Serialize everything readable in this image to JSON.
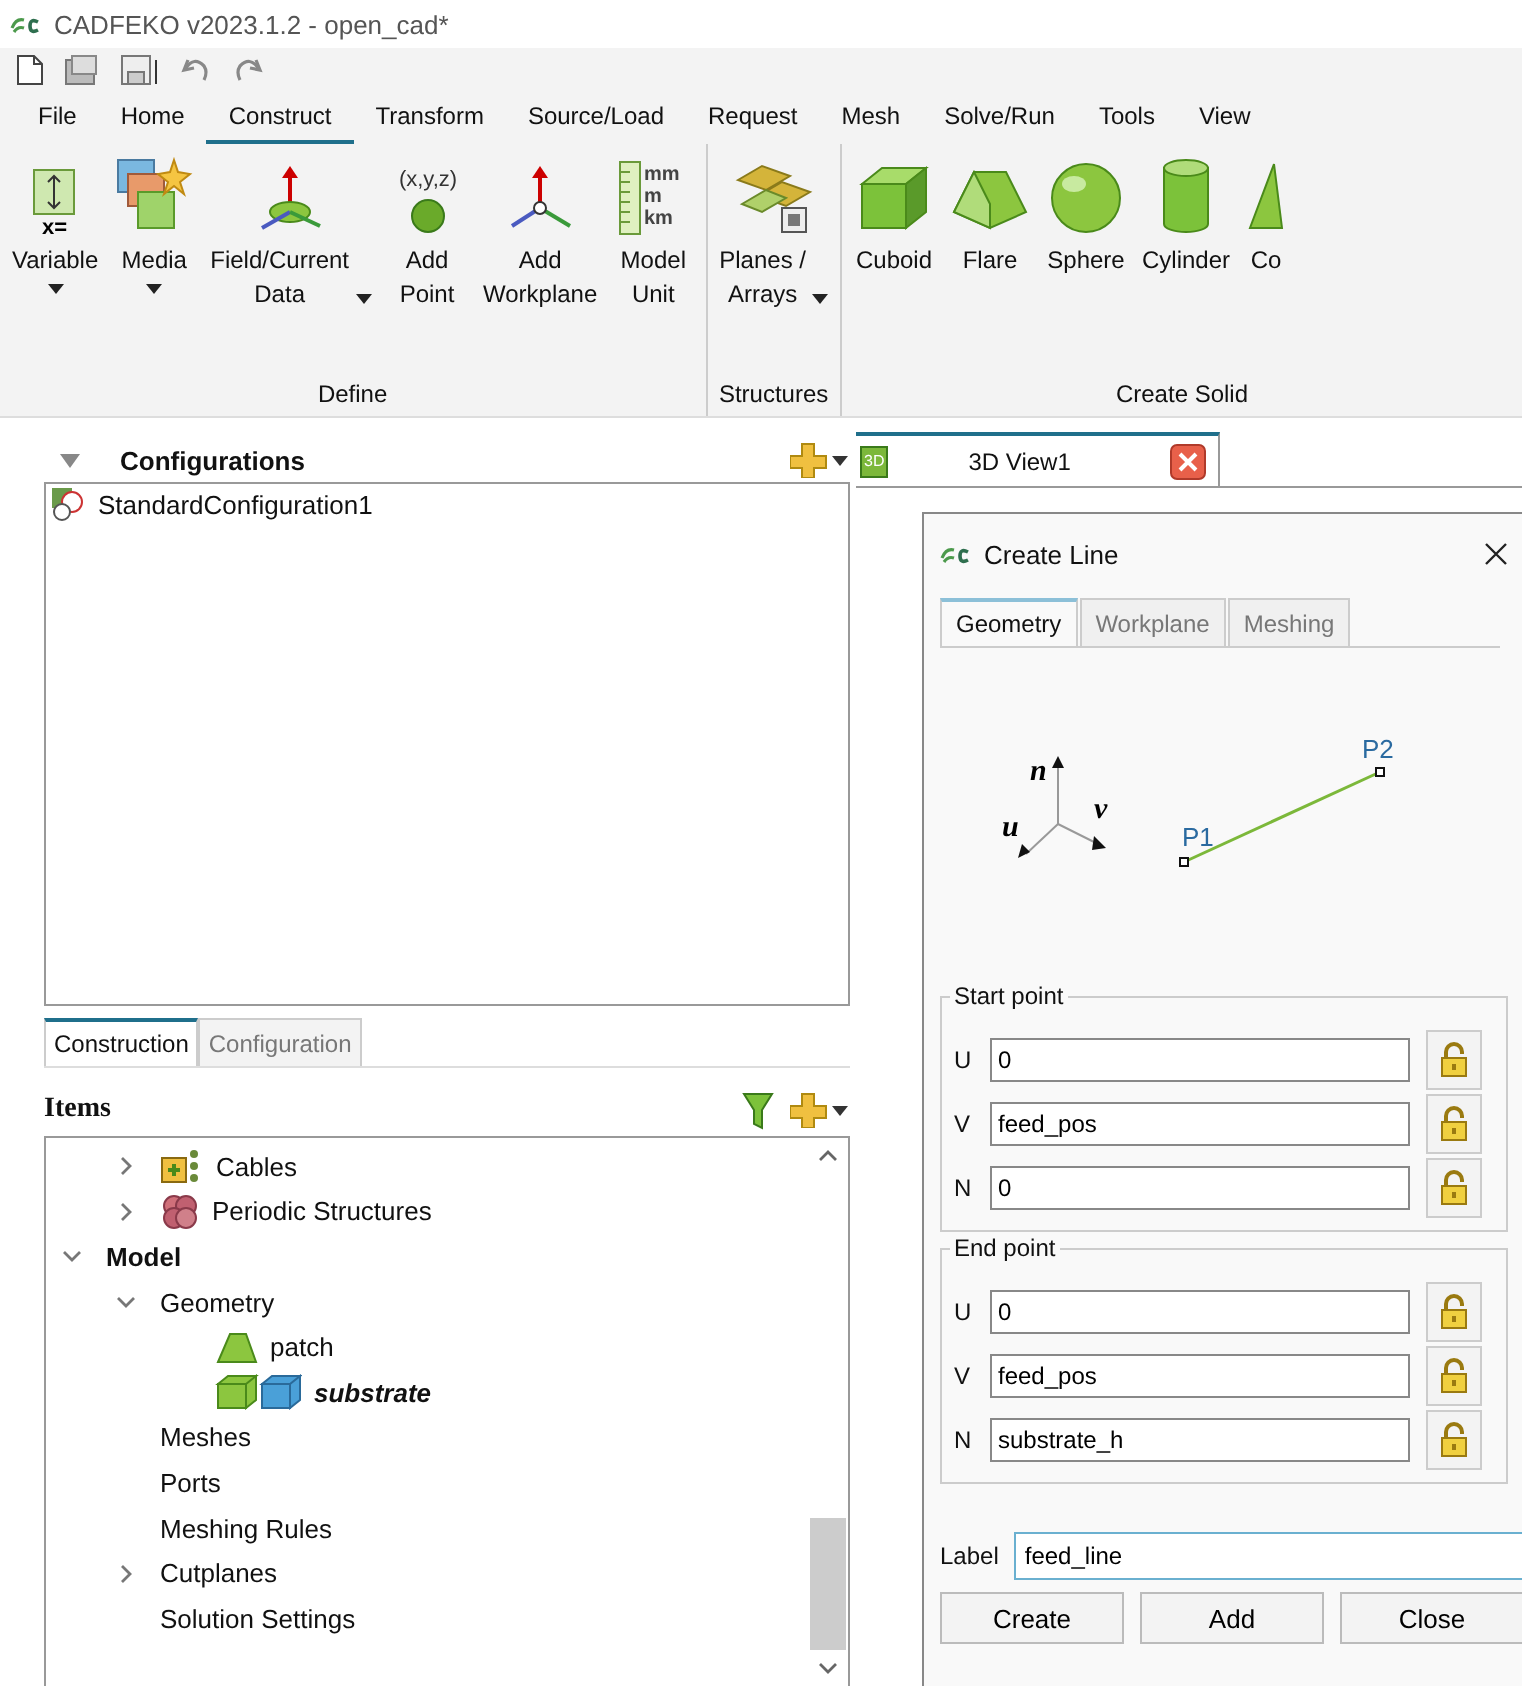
{
  "window": {
    "title": "CADFEKO v2023.1.2 - open_cad*"
  },
  "ribbon_tabs": [
    {
      "label": "File",
      "selected": false
    },
    {
      "label": "Home",
      "selected": false
    },
    {
      "label": "Construct",
      "selected": true
    },
    {
      "label": "Transform",
      "selected": false
    },
    {
      "label": "Source/Load",
      "selected": false
    },
    {
      "label": "Request",
      "selected": false
    },
    {
      "label": "Mesh",
      "selected": false
    },
    {
      "label": "Solve/Run",
      "selected": false
    },
    {
      "label": "Tools",
      "selected": false
    },
    {
      "label": "View",
      "selected": false
    }
  ],
  "ribbon_groups": [
    {
      "label": "Define",
      "buttons": [
        {
          "kind": "variable",
          "label": "Variable",
          "dropdown": true,
          "icon_text": "x="
        },
        {
          "kind": "media",
          "label": "Media",
          "dropdown": true
        },
        {
          "kind": "field",
          "label": "Field/Current\nData",
          "dropdown": true
        },
        {
          "kind": "point",
          "label": "Add\nPoint",
          "icon_text": "(x,y,z)"
        },
        {
          "kind": "workplane",
          "label": "Add\nWorkplane"
        },
        {
          "kind": "unit",
          "label": "Model\nUnit",
          "icon_text": "mm\nm\nkm"
        }
      ]
    },
    {
      "label": "Structures",
      "buttons": [
        {
          "kind": "planes",
          "label": "Planes /\nArrays",
          "dropdown": true
        }
      ]
    },
    {
      "label": "Create Solid",
      "buttons": [
        {
          "kind": "cuboid",
          "label": "Cuboid"
        },
        {
          "kind": "flare",
          "label": "Flare"
        },
        {
          "kind": "sphere",
          "label": "Sphere"
        },
        {
          "kind": "cylinder",
          "label": "Cylinder"
        },
        {
          "kind": "cone",
          "label": "Co"
        }
      ]
    }
  ],
  "configurations": {
    "title": "Configurations",
    "items": [
      "StandardConfiguration1"
    ]
  },
  "panel_tabs": [
    {
      "label": "Construction",
      "selected": true
    },
    {
      "label": "Configuration",
      "selected": false
    }
  ],
  "items_panel": {
    "title": "Items",
    "tree": [
      {
        "children": [
          {
            "label": "Cables",
            "kind": "cables",
            "expanded": false
          },
          {
            "label": "Periodic Structures",
            "kind": "periodic",
            "expanded": false
          }
        ]
      },
      {
        "label": "Model",
        "kind": "heading",
        "expanded": true,
        "children": [
          {
            "label": "Geometry",
            "kind": "plain",
            "expanded": true,
            "children": [
              {
                "label": "patch",
                "kind": "patch",
                "active": false
              },
              {
                "label": "substrate",
                "kind": "solids",
                "active": true
              }
            ]
          },
          {
            "label": "Meshes",
            "kind": "plain"
          },
          {
            "label": "Ports",
            "kind": "plain"
          },
          {
            "label": "Meshing Rules",
            "kind": "plain"
          },
          {
            "label": "Cutplanes",
            "kind": "plain",
            "expanded": false
          },
          {
            "label": "Solution Settings",
            "kind": "plain"
          }
        ]
      }
    ]
  },
  "view_tab": {
    "badge": "3D",
    "label": "3D View1"
  },
  "dialog": {
    "title": "Create Line",
    "tabs": [
      {
        "label": "Geometry",
        "selected": true
      },
      {
        "label": "Workplane",
        "selected": false
      },
      {
        "label": "Meshing",
        "selected": false
      }
    ],
    "diagram": {
      "axes": [
        "n",
        "v",
        "u"
      ],
      "points": [
        "P1",
        "P2"
      ]
    },
    "groups": [
      {
        "title": "Start point",
        "fields": [
          {
            "axis": "U",
            "value": "0",
            "locked": false
          },
          {
            "axis": "V",
            "value": "feed_pos",
            "locked": false
          },
          {
            "axis": "N",
            "value": "0",
            "locked": false
          }
        ]
      },
      {
        "title": "End point",
        "fields": [
          {
            "axis": "U",
            "value": "0",
            "locked": false
          },
          {
            "axis": "V",
            "value": "feed_pos",
            "locked": false
          },
          {
            "axis": "N",
            "value": "substrate_h",
            "locked": false
          }
        ]
      }
    ],
    "label_field": {
      "label": "Label",
      "value": "feed_line"
    },
    "buttons": [
      "Create",
      "Add",
      "Close"
    ]
  }
}
